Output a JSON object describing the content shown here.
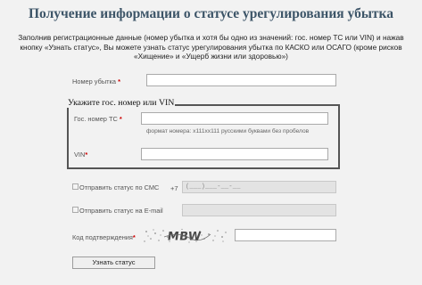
{
  "page": {
    "title": "Получение информации о статусе урегулирования убытка",
    "intro": [
      "Заполнив регистрационные данные (номер убытка и хотя бы одно из значений: гос. номер ТС или VIN) и нажав",
      "кнопку «Узнать статус», Вы можете узнать статус урегулирования убытка по КАСКО или ОСАГО (кроме рисков",
      "«Хищение» и «Ущерб жизни или здоровью»)"
    ]
  },
  "form": {
    "claim_number": {
      "label": "Номер убытка",
      "required_mark": "*",
      "value": ""
    },
    "vehicle_group": {
      "legend": "Укажите гос. номер или VIN",
      "plate": {
        "label": "Гос. номер ТС",
        "required_mark": "*",
        "value": "",
        "hint": "формат номера: х111хх111 русскими буквами без пробелов"
      },
      "vin": {
        "label": "VIN",
        "required_mark": "*",
        "value": ""
      }
    },
    "sms": {
      "label": "Отправить статус по СМС",
      "checked": false,
      "prefix": "+7",
      "mask": "(___)___-__-__"
    },
    "email": {
      "label": "Отправить статус на E-mail",
      "checked": false,
      "value": ""
    },
    "captcha": {
      "label": "Код подтверждения",
      "required_mark": "*",
      "image_text": "MBW",
      "value": ""
    },
    "submit_label": "Узнать статус"
  }
}
